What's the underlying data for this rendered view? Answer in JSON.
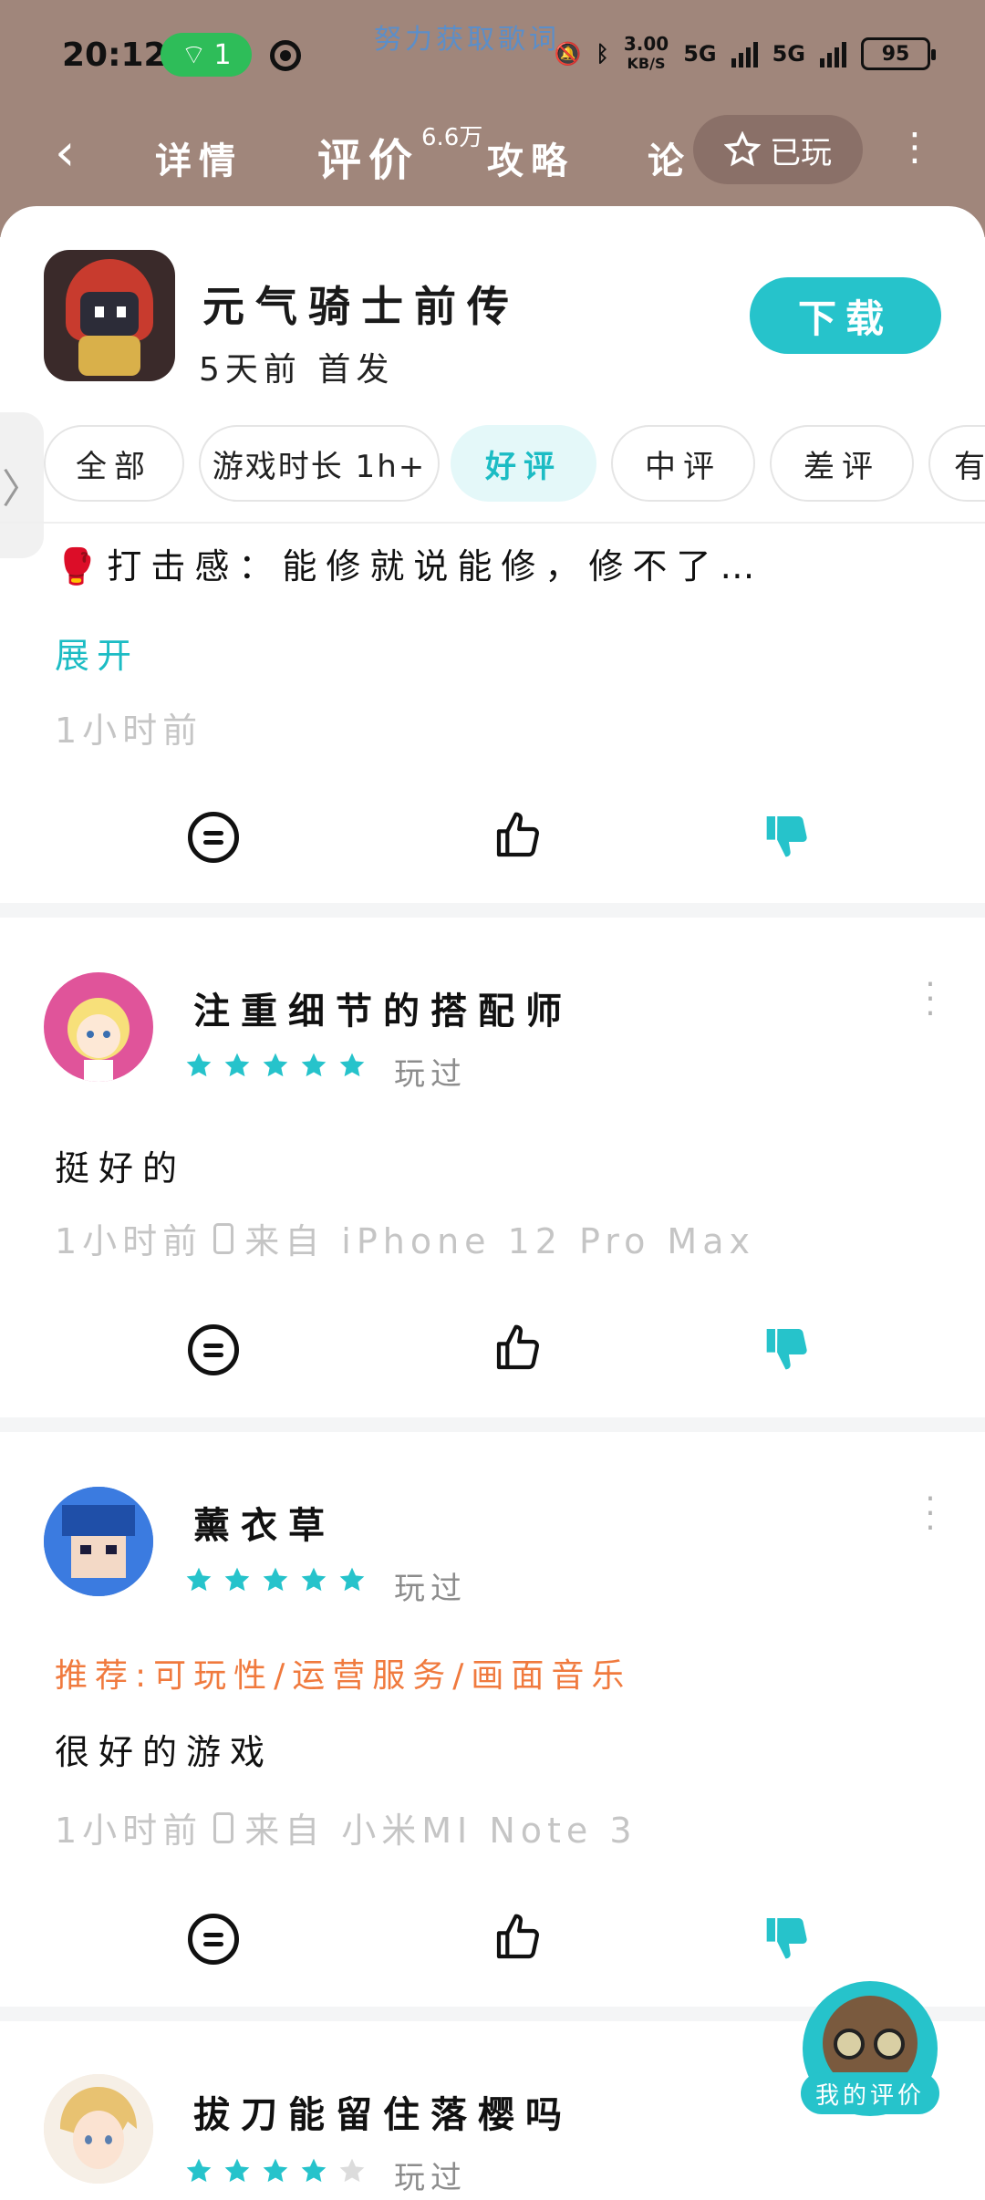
{
  "status_bar": {
    "time": "20:12",
    "hotspot_count": "1",
    "lyric": "努力获取歌词",
    "net_speed": "3.00",
    "net_unit": "KB/S",
    "sim1": "5G",
    "sim2": "5G",
    "battery": "95"
  },
  "nav": {
    "back_icon": "back-arrow-icon",
    "tabs": [
      {
        "label": "详情"
      },
      {
        "label": "评价"
      },
      {
        "label": "攻略"
      },
      {
        "label": "论"
      }
    ],
    "review_count": "6.6万",
    "played_label": "已玩",
    "more_icon": "more-vertical-icon"
  },
  "game": {
    "title": "元气骑士前传",
    "subtitle": "5天前 首发",
    "download_label": "下载"
  },
  "filters": [
    {
      "label": "全部"
    },
    {
      "label": "游戏时长 1h+"
    },
    {
      "label": "好评"
    },
    {
      "label": "中评"
    },
    {
      "label": "差评"
    },
    {
      "label": "有"
    }
  ],
  "reviews": [
    {
      "text": "🥊打击感：能修就说能修，修不了…",
      "expand": "展开",
      "time": "1小时前"
    },
    {
      "username": "注重细节的搭配师",
      "rating": 5,
      "played": "玩过",
      "text": "挺好的",
      "time": "1小时前",
      "device": "来自 iPhone 12 Pro Max"
    },
    {
      "username": "薰衣草",
      "rating": 5,
      "played": "玩过",
      "recommend": "推荐:可玩性/运营服务/画面音乐",
      "text": "很好的游戏",
      "time": "1小时前",
      "device": "来自 小米MI Note 3"
    },
    {
      "username": "拔刀能留住落樱吗",
      "rating": 4,
      "played": "玩过"
    }
  ],
  "my_review_label": "我的评价",
  "colors": {
    "accent": "#26c3cb",
    "header_bg": "#a0867b",
    "recommend": "#f07a3e"
  }
}
